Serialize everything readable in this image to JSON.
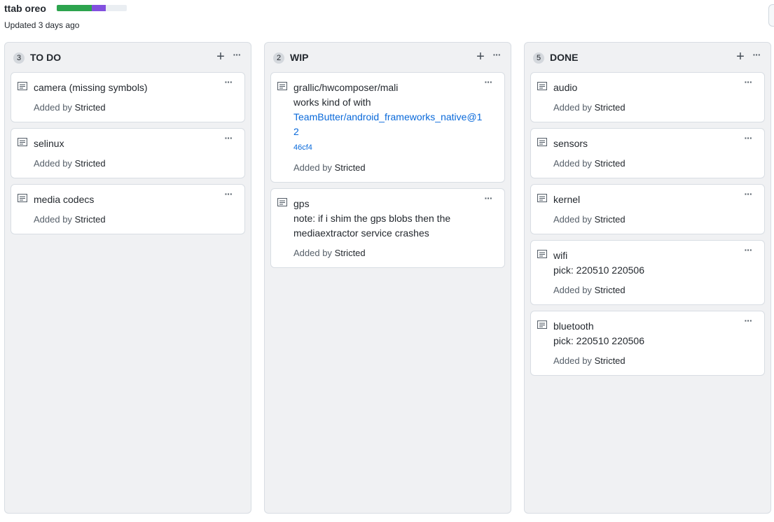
{
  "project": {
    "title": "ttab oreo",
    "updated": "Updated 3 days ago",
    "progress": {
      "done_fraction": 0.5,
      "in_progress_fraction": 0.2,
      "done_color": "#2da44e",
      "in_progress_color": "#8250df",
      "track_color": "#eaeef2"
    }
  },
  "columns": [
    {
      "count": "3",
      "name": "TO DO",
      "add_icon": "plus-icon",
      "more_icon": "kebab-horizontal-icon",
      "cards": [
        {
          "icon": "note-icon",
          "title": "camera (missing symbols)",
          "added_by_label": "Added by",
          "author": "Stricted"
        },
        {
          "icon": "note-icon",
          "title": "selinux",
          "added_by_label": "Added by",
          "author": "Stricted"
        },
        {
          "icon": "note-icon",
          "title": "media codecs",
          "added_by_label": "Added by",
          "author": "Stricted"
        }
      ]
    },
    {
      "count": "2",
      "name": "WIP",
      "add_icon": "plus-icon",
      "more_icon": "kebab-horizontal-icon",
      "cards": [
        {
          "icon": "note-icon",
          "title": "grallic/hwcomposer/mali",
          "note": "works kind of with",
          "link": "TeamButter/android_frameworks_native@12",
          "link_suffix": "46cf4",
          "added_by_label": "Added by",
          "author": "Stricted"
        },
        {
          "icon": "note-icon",
          "title": "gps",
          "note": "note: if i shim the gps blobs then the mediaextractor service crashes",
          "added_by_label": "Added by",
          "author": "Stricted"
        }
      ]
    },
    {
      "count": "5",
      "name": "DONE",
      "add_icon": "plus-icon",
      "more_icon": "kebab-horizontal-icon",
      "cards": [
        {
          "icon": "note-icon",
          "title": "audio",
          "added_by_label": "Added by",
          "author": "Stricted"
        },
        {
          "icon": "note-icon",
          "title": "sensors",
          "added_by_label": "Added by",
          "author": "Stricted"
        },
        {
          "icon": "note-icon",
          "title": "kernel",
          "added_by_label": "Added by",
          "author": "Stricted"
        },
        {
          "icon": "note-icon",
          "title": "wifi",
          "note": "pick: 220510 220506",
          "added_by_label": "Added by",
          "author": "Stricted"
        },
        {
          "icon": "note-icon",
          "title": "bluetooth",
          "note": "pick: 220510 220506",
          "added_by_label": "Added by",
          "author": "Stricted"
        }
      ]
    }
  ]
}
